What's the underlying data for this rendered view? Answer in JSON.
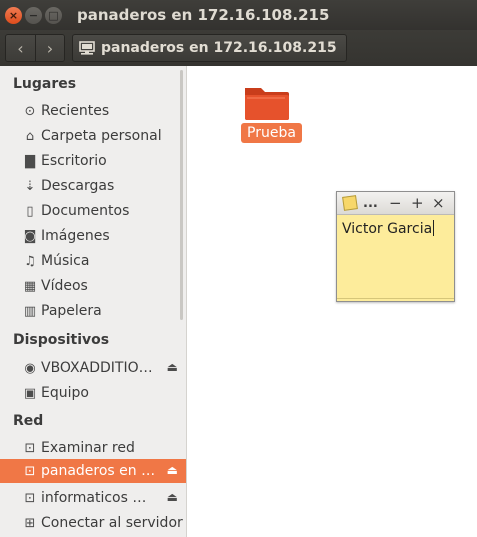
{
  "window": {
    "title": "panaderos en 172.16.108.215"
  },
  "window_controls": {
    "close": "×",
    "minimize": "−",
    "maximize": "□"
  },
  "toolbar": {
    "back": "‹",
    "forward": "›",
    "path_label": "panaderos en 172.16.108.215"
  },
  "sidebar": {
    "sections": [
      {
        "title": "Lugares"
      },
      {
        "title": "Dispositivos"
      },
      {
        "title": "Red"
      }
    ],
    "places": [
      {
        "label": "Recientes",
        "icon": "clock-icon",
        "glyph": "⊙"
      },
      {
        "label": "Carpeta personal",
        "icon": "home-icon",
        "glyph": "⌂"
      },
      {
        "label": "Escritorio",
        "icon": "folder-icon",
        "glyph": "▇"
      },
      {
        "label": "Descargas",
        "icon": "download-icon",
        "glyph": "⇣"
      },
      {
        "label": "Documentos",
        "icon": "document-icon",
        "glyph": "▯"
      },
      {
        "label": "Imágenes",
        "icon": "camera-icon",
        "glyph": "◙"
      },
      {
        "label": "Música",
        "icon": "music-icon",
        "glyph": "♫"
      },
      {
        "label": "Vídeos",
        "icon": "film-icon",
        "glyph": "▦"
      },
      {
        "label": "Papelera",
        "icon": "trash-icon",
        "glyph": "▥"
      }
    ],
    "devices": [
      {
        "label": "VBOXADDITIO…",
        "icon": "disc-icon",
        "glyph": "◉",
        "eject": "⏏"
      },
      {
        "label": "Equipo",
        "icon": "computer-icon",
        "glyph": "▣"
      }
    ],
    "network": [
      {
        "label": "Examinar red",
        "icon": "network-icon",
        "glyph": "⊡"
      },
      {
        "label": "panaderos en …",
        "icon": "network-share-icon",
        "glyph": "⊡",
        "eject": "⏏",
        "active": true
      },
      {
        "label": "informaticos …",
        "icon": "network-share-icon",
        "glyph": "⊡",
        "eject": "⏏"
      },
      {
        "label": "Conectar al servidor",
        "icon": "server-connect-icon",
        "glyph": "⊞"
      }
    ]
  },
  "main": {
    "items": [
      {
        "name": "Prueba",
        "icon": "folder-icon",
        "color": "#e6522c"
      }
    ]
  },
  "sticky_note": {
    "menu": "...",
    "minimize": "−",
    "add": "+",
    "close": "×",
    "text": "Victor Garcia"
  },
  "colors": {
    "accent": "#f07746",
    "titlebar": "#3c3b37",
    "sidebar": "#efeeed",
    "note": "#fdec9b"
  }
}
